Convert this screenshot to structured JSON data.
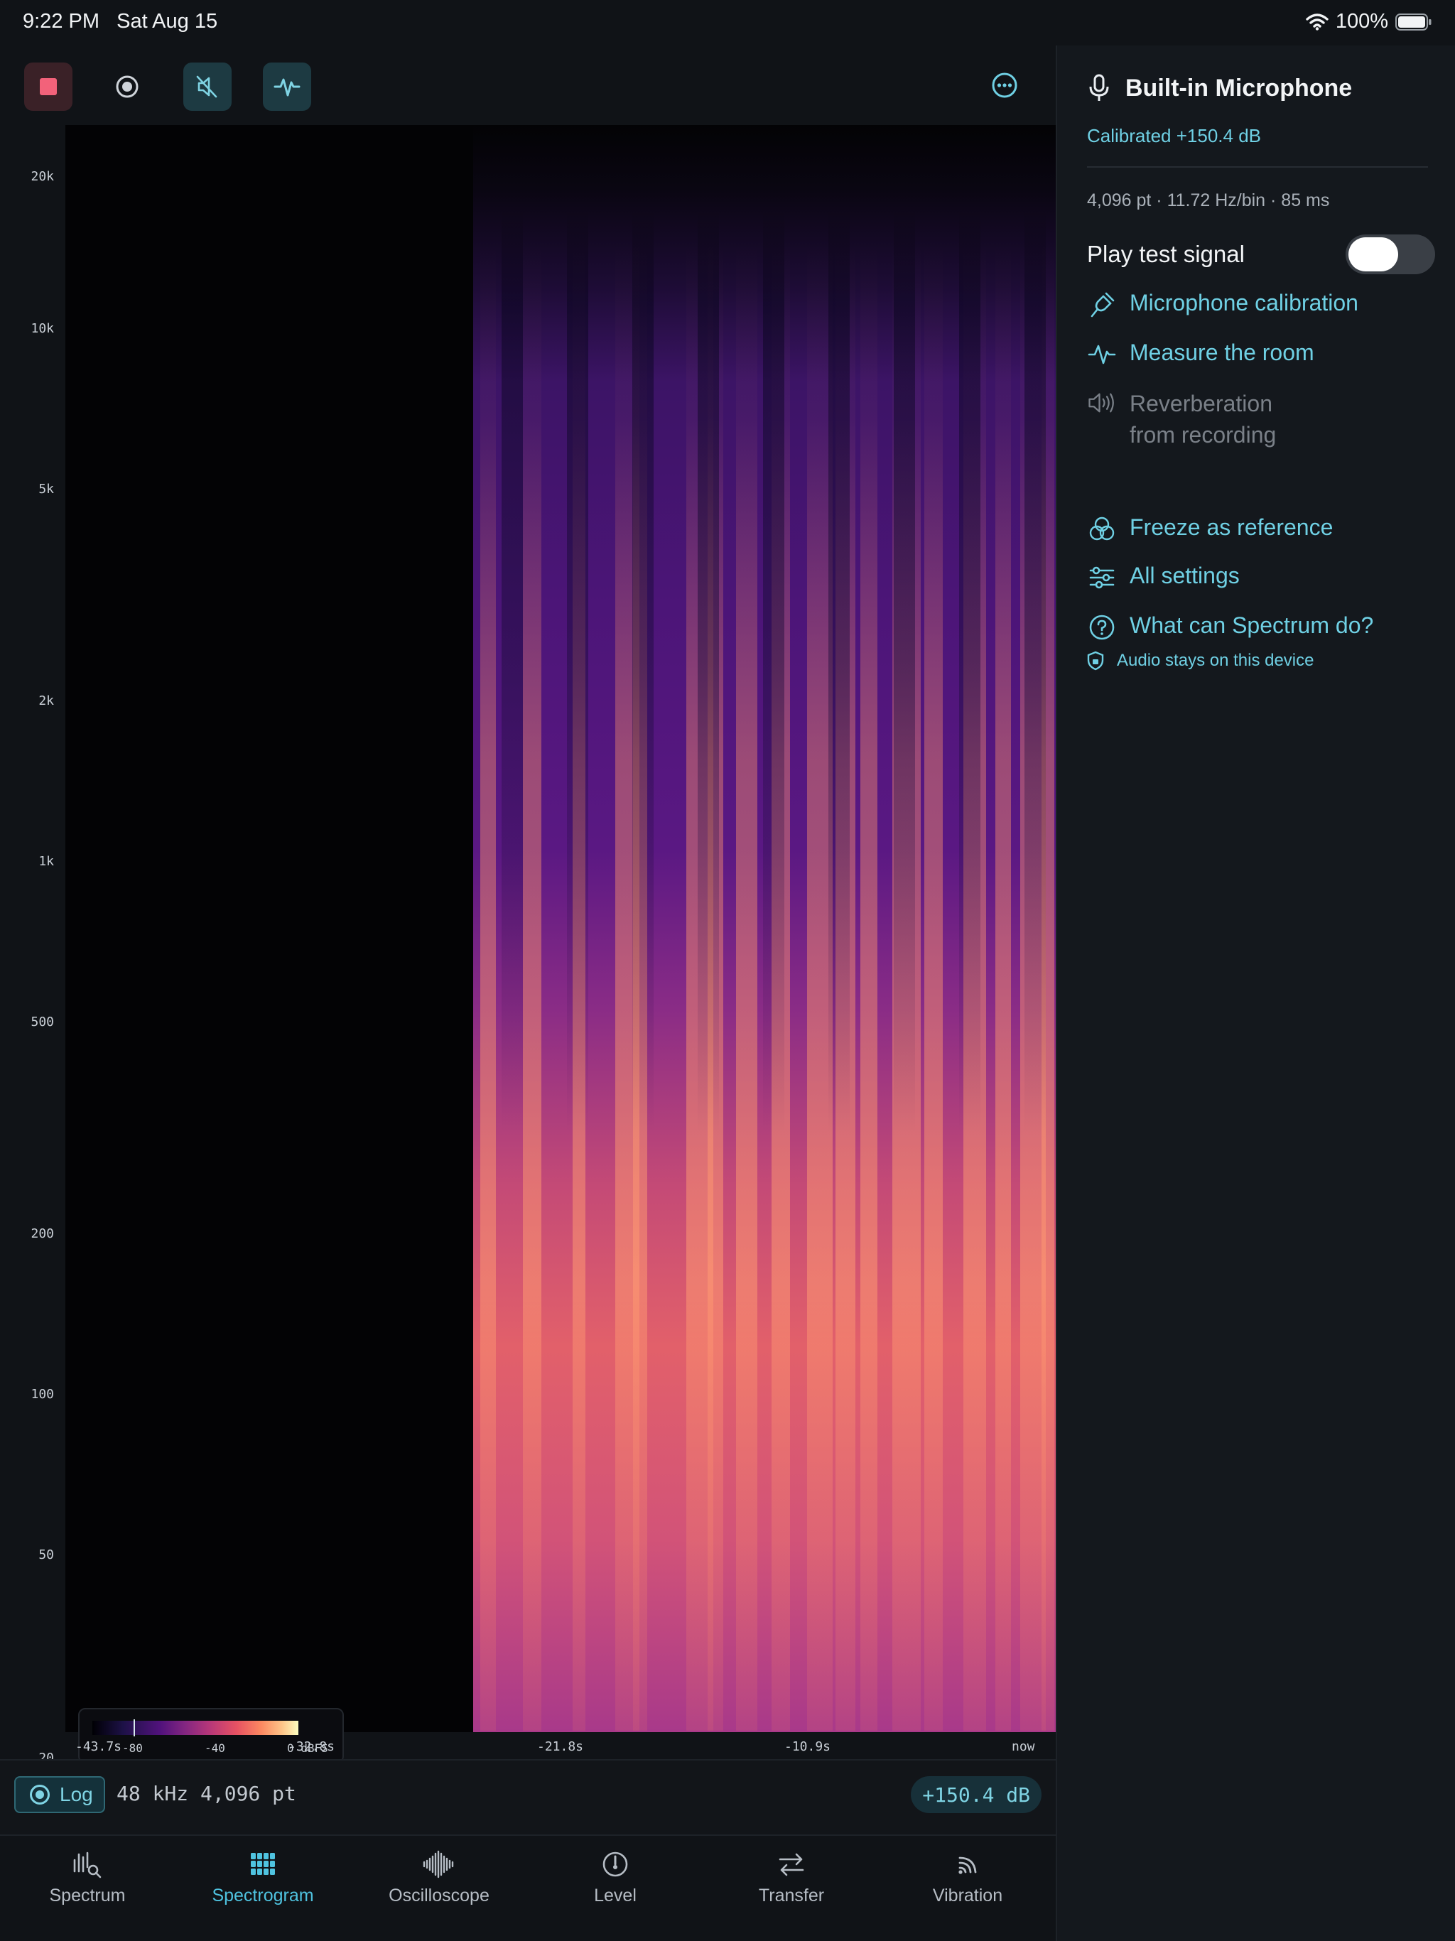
{
  "status": {
    "time": "9:22 PM",
    "date": "Sat Aug 15",
    "battery": "100%"
  },
  "toolbar": {
    "stop": "stop-icon",
    "record": "record-icon",
    "mute": "speaker-muted-icon",
    "pulse": "waveform-icon",
    "more": "more-icon"
  },
  "plot": {
    "y_ticks": [
      "20k",
      "10k",
      "5k",
      "2k",
      "1k",
      "500",
      "200",
      "100",
      "50",
      "20"
    ],
    "x_ticks": [
      "-43.7s",
      "-32.8s",
      "-21.8s",
      "-10.9s",
      "now"
    ],
    "legend": {
      "labels": [
        "-80",
        "-40",
        "0"
      ],
      "unit": "dBFS"
    },
    "scale": "log",
    "colormap": "magma"
  },
  "footer": {
    "log_label": "Log",
    "sample_info": "48 kHz 4,096 pt",
    "gain": "+150.4 dB"
  },
  "tabs": [
    {
      "label": "Spectrum",
      "icon": "spectrum-icon",
      "active": false
    },
    {
      "label": "Spectrogram",
      "icon": "grid-icon",
      "active": true
    },
    {
      "label": "Oscilloscope",
      "icon": "oscilloscope-icon",
      "active": false
    },
    {
      "label": "Level",
      "icon": "gauge-icon",
      "active": false
    },
    {
      "label": "Transfer",
      "icon": "arrows-icon",
      "active": false
    },
    {
      "label": "Vibration",
      "icon": "vibration-icon",
      "active": false
    }
  ],
  "sidebar": {
    "title": "Built-in Microphone",
    "calibrated": "Calibrated +150.4 dB",
    "fft_info": "4,096 pt · 11.72 Hz/bin · 85 ms",
    "play_label": "Play test signal",
    "play_on": false,
    "menu": [
      {
        "label": "Microphone calibration",
        "icon": "tuning-fork-icon",
        "enabled": true
      },
      {
        "label": "Measure the room",
        "icon": "pulse-icon",
        "enabled": true
      },
      {
        "label": "Reverberation from recording",
        "icon": "speaker-icon",
        "enabled": false
      },
      {
        "label": "Freeze as reference",
        "icon": "circles-icon",
        "enabled": true
      },
      {
        "label": "All settings",
        "icon": "sliders-icon",
        "enabled": true
      },
      {
        "label": "What can Spectrum do?",
        "icon": "help-icon",
        "enabled": true
      }
    ],
    "privacy": "Audio stays on this device"
  },
  "colors": {
    "accent": "#6fd0e4",
    "stop": "#f2627a",
    "bg": "#101317"
  }
}
